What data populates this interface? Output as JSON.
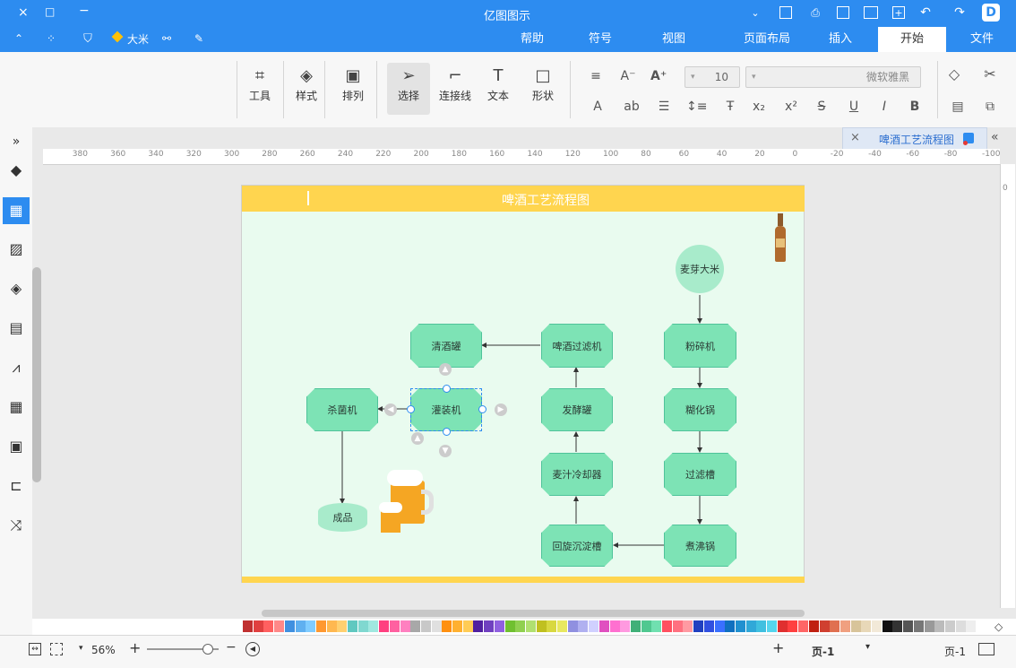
{
  "window": {
    "title": "亿图图示"
  },
  "titlebar_right": {
    "close": "×",
    "maximize": "□",
    "minimize": "−"
  },
  "menu_tabs": [
    {
      "label": "文件",
      "active": false
    },
    {
      "label": "开始",
      "active": true
    },
    {
      "label": "插入",
      "active": false
    },
    {
      "label": "页面布局",
      "active": false
    },
    {
      "label": "视图",
      "active": false
    },
    {
      "label": "符号",
      "active": false
    },
    {
      "label": "帮助",
      "active": false
    }
  ],
  "user": {
    "name": "大米"
  },
  "ribbon": {
    "font_name": "微软雅黑",
    "font_size": "10",
    "tools": [
      {
        "label": "形状",
        "icon": "square-icon"
      },
      {
        "label": "文本",
        "icon": "text-icon"
      },
      {
        "label": "连接线",
        "icon": "connector-icon"
      },
      {
        "label": "选择",
        "icon": "pointer-icon"
      },
      {
        "label": "排列",
        "icon": "arrange-icon"
      },
      {
        "label": "样式",
        "icon": "fill-bucket-icon"
      },
      {
        "label": "工具",
        "icon": "tools-icon"
      }
    ]
  },
  "document_tab": {
    "label": "啤酒工艺流程图"
  },
  "ruler": {
    "labels": [
      "-100",
      "-80",
      "-60",
      "-40",
      "-20",
      "0",
      "20",
      "40",
      "60",
      "80",
      "100",
      "120",
      "140",
      "160",
      "180",
      "200",
      "220",
      "240",
      "260",
      "280",
      "300",
      "320",
      "340",
      "360",
      "380"
    ],
    "vertical_zero": "0"
  },
  "diagram": {
    "title": "啤酒工艺流程图",
    "start": "麦芽大米",
    "steps_right": [
      "粉碎机",
      "糊化锅",
      "过滤槽",
      "煮沸锅"
    ],
    "steps_mid": [
      "回旋沉淀槽",
      "麦汁冷却器",
      "发酵罐",
      "啤酒过滤机"
    ],
    "steps_left": [
      "清酒罐",
      "灌装机",
      "杀菌机"
    ],
    "end": "成品"
  },
  "status": {
    "page_label": "页-1",
    "page_tab": "页-1",
    "zoom": "56%",
    "add": "+"
  },
  "colors": {
    "brand": "#2d8cf0",
    "header": "#ffd54f",
    "canvas": "#e9fbef",
    "node": "#7de3b5",
    "node_border": "#4fc39a"
  }
}
